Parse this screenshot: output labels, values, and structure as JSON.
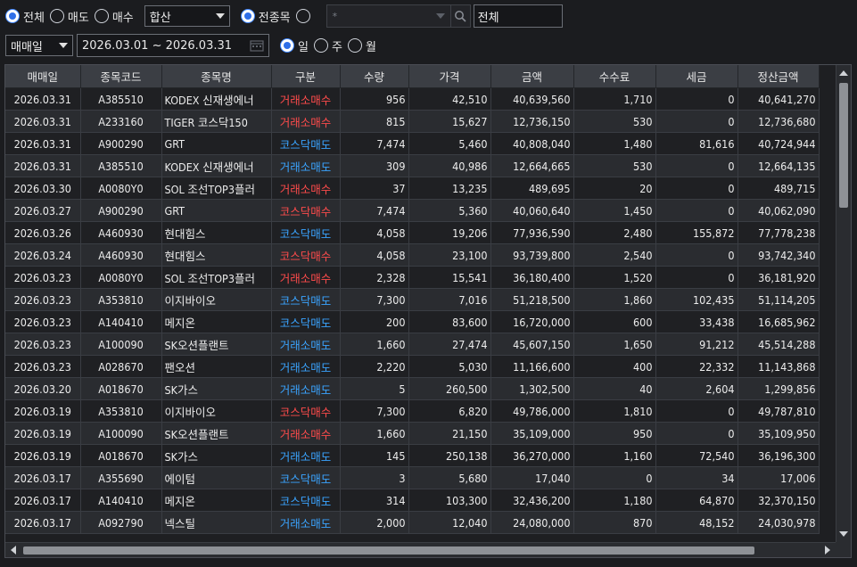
{
  "filters": {
    "trade_type": {
      "options": [
        "전체",
        "매도",
        "매수"
      ],
      "selected": 0
    },
    "combine_select": "합산",
    "stock_scope": {
      "all_label": "전종목",
      "all_selected": true
    },
    "stock_code_placeholder": "*",
    "account_select": "전체",
    "date_type_select": "매매일",
    "date_range": "2026.03.01 ~ 2026.03.31",
    "period": {
      "options": [
        "일",
        "주",
        "월"
      ],
      "selected": 0
    }
  },
  "table": {
    "headers": [
      "매매일",
      "종목코드",
      "종목명",
      "구분",
      "수량",
      "가격",
      "금액",
      "수수료",
      "세금",
      "정산금액"
    ],
    "rows": [
      [
        "2026.03.31",
        "A385510",
        "KODEX 신재생에너",
        "거래소매수",
        "956",
        "42,510",
        "40,639,560",
        "1,710",
        "0",
        "40,641,270"
      ],
      [
        "2026.03.31",
        "A233160",
        "TIGER 코스닥150",
        "거래소매수",
        "815",
        "15,627",
        "12,736,150",
        "530",
        "0",
        "12,736,680"
      ],
      [
        "2026.03.31",
        "A900290",
        "GRT",
        "코스닥매도",
        "7,474",
        "5,460",
        "40,808,040",
        "1,480",
        "81,616",
        "40,724,944"
      ],
      [
        "2026.03.31",
        "A385510",
        "KODEX 신재생에너",
        "거래소매도",
        "309",
        "40,986",
        "12,664,665",
        "530",
        "0",
        "12,664,135"
      ],
      [
        "2026.03.30",
        "A0080Y0",
        "SOL 조선TOP3플러",
        "거래소매수",
        "37",
        "13,235",
        "489,695",
        "20",
        "0",
        "489,715"
      ],
      [
        "2026.03.27",
        "A900290",
        "GRT",
        "코스닥매수",
        "7,474",
        "5,360",
        "40,060,640",
        "1,450",
        "0",
        "40,062,090"
      ],
      [
        "2026.03.26",
        "A460930",
        "현대힘스",
        "코스닥매도",
        "4,058",
        "19,206",
        "77,936,590",
        "2,480",
        "155,872",
        "77,778,238"
      ],
      [
        "2026.03.24",
        "A460930",
        "현대힘스",
        "코스닥매수",
        "4,058",
        "23,100",
        "93,739,800",
        "2,540",
        "0",
        "93,742,340"
      ],
      [
        "2026.03.23",
        "A0080Y0",
        "SOL 조선TOP3플러",
        "거래소매수",
        "2,328",
        "15,541",
        "36,180,400",
        "1,520",
        "0",
        "36,181,920"
      ],
      [
        "2026.03.23",
        "A353810",
        "이지바이오",
        "코스닥매도",
        "7,300",
        "7,016",
        "51,218,500",
        "1,860",
        "102,435",
        "51,114,205"
      ],
      [
        "2026.03.23",
        "A140410",
        "메지온",
        "코스닥매도",
        "200",
        "83,600",
        "16,720,000",
        "600",
        "33,438",
        "16,685,962"
      ],
      [
        "2026.03.23",
        "A100090",
        "SK오션플랜트",
        "거래소매도",
        "1,660",
        "27,474",
        "45,607,150",
        "1,650",
        "91,212",
        "45,514,288"
      ],
      [
        "2026.03.23",
        "A028670",
        "팬오션",
        "거래소매도",
        "2,220",
        "5,030",
        "11,166,600",
        "400",
        "22,332",
        "11,143,868"
      ],
      [
        "2026.03.20",
        "A018670",
        "SK가스",
        "거래소매도",
        "5",
        "260,500",
        "1,302,500",
        "40",
        "2,604",
        "1,299,856"
      ],
      [
        "2026.03.19",
        "A353810",
        "이지바이오",
        "코스닥매수",
        "7,300",
        "6,820",
        "49,786,000",
        "1,810",
        "0",
        "49,787,810"
      ],
      [
        "2026.03.19",
        "A100090",
        "SK오션플랜트",
        "거래소매수",
        "1,660",
        "21,150",
        "35,109,000",
        "950",
        "0",
        "35,109,950"
      ],
      [
        "2026.03.19",
        "A018670",
        "SK가스",
        "거래소매도",
        "145",
        "250,138",
        "36,270,000",
        "1,160",
        "72,540",
        "36,196,300"
      ],
      [
        "2026.03.17",
        "A355690",
        "에이텀",
        "코스닥매도",
        "3",
        "5,680",
        "17,040",
        "0",
        "34",
        "17,006"
      ],
      [
        "2026.03.17",
        "A140410",
        "메지온",
        "코스닥매도",
        "314",
        "103,300",
        "32,436,200",
        "1,180",
        "64,870",
        "32,370,150"
      ],
      [
        "2026.03.17",
        "A092790",
        "넥스틸",
        "거래소매도",
        "2,000",
        "12,040",
        "24,080,000",
        "870",
        "48,152",
        "24,030,978"
      ]
    ]
  },
  "colors": {
    "buy": "#ff4b4b",
    "sell": "#3aa4ff",
    "accent": "#2f6fe8"
  }
}
